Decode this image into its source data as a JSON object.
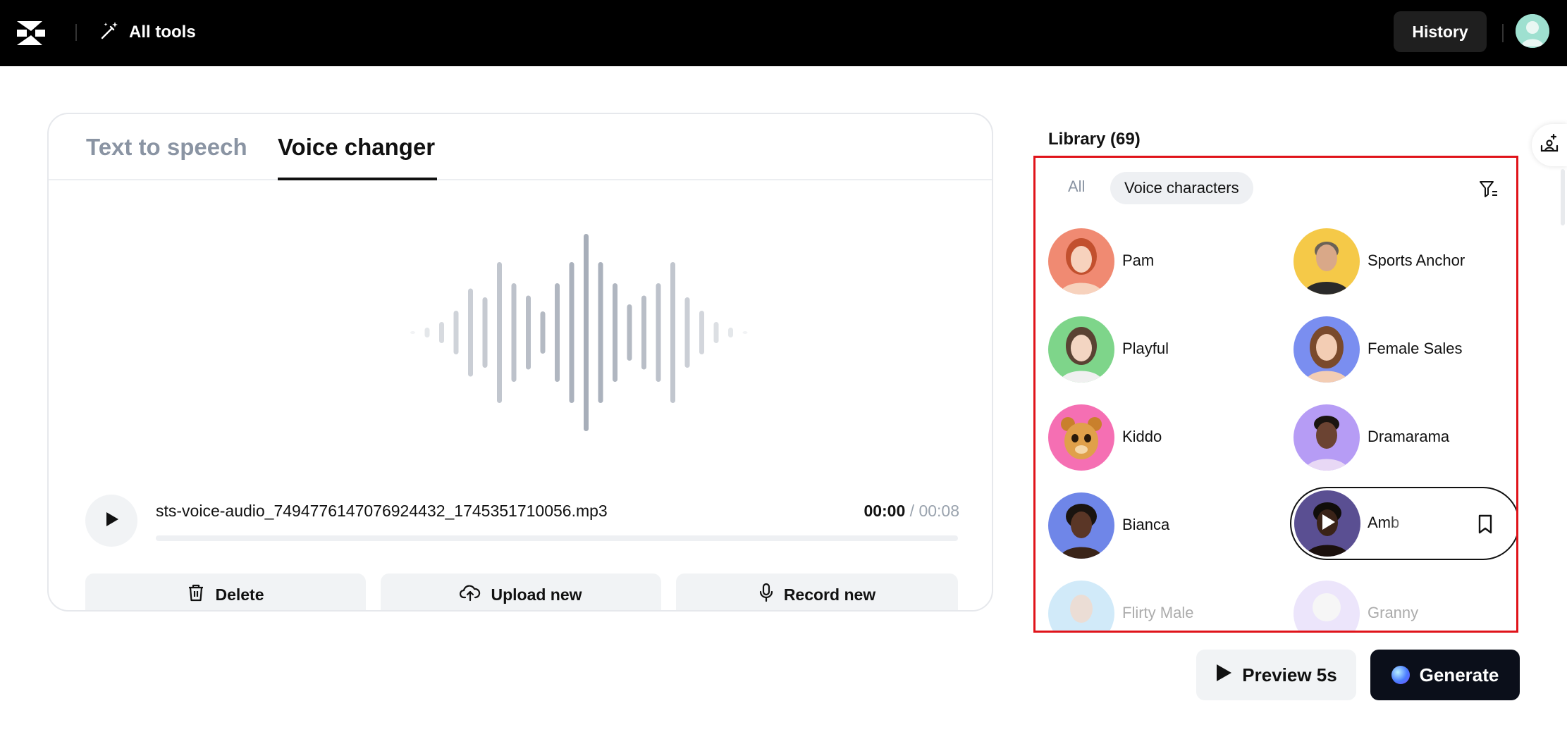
{
  "topbar": {
    "all_tools_label": "All tools",
    "history_label": "History"
  },
  "tabs": {
    "text_to_speech": "Text to speech",
    "voice_changer": "Voice changer",
    "active": "voice_changer"
  },
  "player": {
    "filename": "sts-voice-audio_7494776147076924432_1745351710056.mp3",
    "current_time": "00:00",
    "separator": " / ",
    "total_time": "00:08",
    "progress": 0
  },
  "actions": {
    "delete_label": "Delete",
    "upload_label": "Upload new",
    "record_label": "Record new"
  },
  "library": {
    "title": "Library (69)",
    "filter_all": "All",
    "filter_voice_characters": "Voice characters",
    "voices": [
      {
        "name": "Pam",
        "bg": "#f08a72"
      },
      {
        "name": "Sports Anchor",
        "bg": "#f5c948"
      },
      {
        "name": "Playful",
        "bg": "#7ed58a"
      },
      {
        "name": "Female Sales",
        "bg": "#7a8ef0"
      },
      {
        "name": "Kiddo",
        "bg": "#f56fb3"
      },
      {
        "name": "Dramarama",
        "bg": "#b69cf5"
      },
      {
        "name": "Bianca",
        "bg": "#6f86e8"
      },
      {
        "name": "Amb",
        "bg": "#8a7ae0"
      },
      {
        "name": "Flirty Male",
        "bg": "#7ec6f0"
      },
      {
        "name": "Granny",
        "bg": "#c9b6f5"
      }
    ],
    "selected_index": 7
  },
  "footer": {
    "preview_label": "Preview 5s",
    "generate_label": "Generate"
  },
  "colors": {
    "accent_highlight": "#e0131a",
    "topbar_bg": "#000000",
    "generate_bg": "#0b0f1a"
  }
}
